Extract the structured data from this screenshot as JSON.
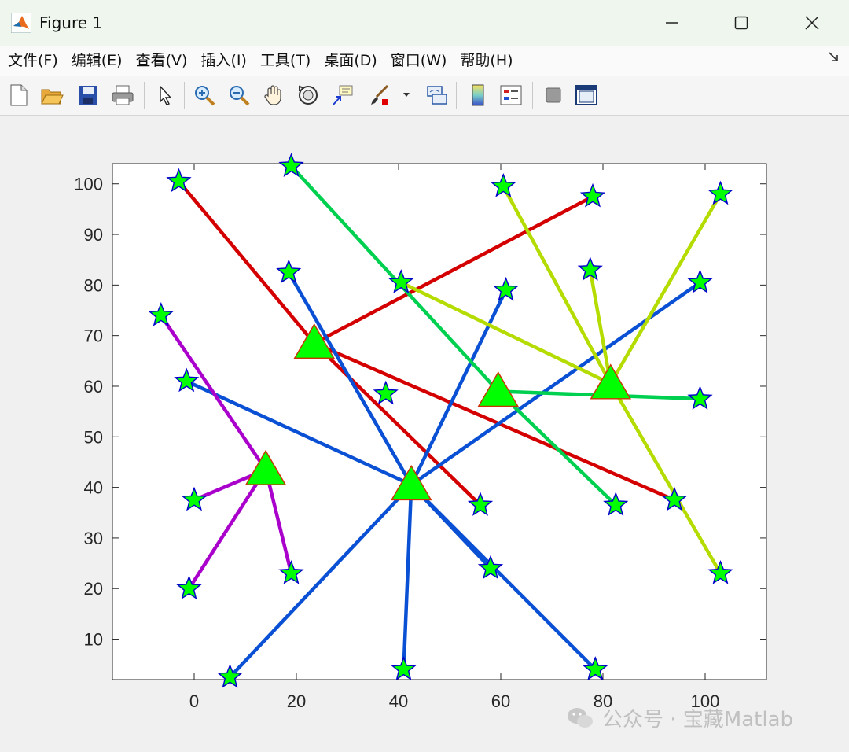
{
  "window": {
    "title": "Figure 1",
    "minimize": "—",
    "maximize": "☐",
    "close": "✕"
  },
  "menu": [
    "文件(F)",
    "编辑(E)",
    "查看(V)",
    "插入(I)",
    "工具(T)",
    "桌面(D)",
    "窗口(W)",
    "帮助(H)"
  ],
  "toolbar": {
    "icons": [
      "new-file-icon",
      "open-folder-icon",
      "save-icon",
      "print-icon",
      "pointer-icon",
      "zoom-in-icon",
      "zoom-out-icon",
      "pan-hand-icon",
      "rotate-3d-icon",
      "data-cursor-icon",
      "brush-icon",
      "link-plot-icon",
      "colorbar-icon",
      "legend-icon",
      "hide-plot-tools-icon",
      "show-plot-tools-icon"
    ]
  },
  "watermark": "公众号 · 宝藏Matlab",
  "colors": {
    "red": "#d40000",
    "blue": "#0a50d4",
    "purple": "#aa00cc",
    "green": "#00d050",
    "yellowgreen": "#b4dc00",
    "marker_fill": "#00ff00",
    "star_edge": "#0000cc",
    "triangle_edge": "#cc3300"
  },
  "chart_data": {
    "type": "scatter",
    "title": "",
    "xlabel": "",
    "ylabel": "",
    "xlim": [
      -16,
      112
    ],
    "ylim": [
      2,
      104
    ],
    "xticks": [
      0,
      20,
      40,
      60,
      80,
      100
    ],
    "yticks": [
      10,
      20,
      30,
      40,
      50,
      60,
      70,
      80,
      90,
      100
    ],
    "grid": false,
    "centers": [
      {
        "color": "red",
        "x": 23.5,
        "y": 68.5
      },
      {
        "color": "blue",
        "x": 42.5,
        "y": 40.5
      },
      {
        "color": "purple",
        "x": 14,
        "y": 43.5
      },
      {
        "color": "green",
        "x": 59.5,
        "y": 59
      },
      {
        "color": "yellowgreen",
        "x": 81.5,
        "y": 60.5
      }
    ],
    "clusters": [
      {
        "center": 0,
        "points": [
          [
            -3,
            100.5
          ],
          [
            78,
            97.5
          ],
          [
            56,
            36.5
          ],
          [
            94,
            37.5
          ]
        ]
      },
      {
        "center": 1,
        "points": [
          [
            18.5,
            82.5
          ],
          [
            61,
            79
          ],
          [
            -1.5,
            61
          ],
          [
            99,
            80.5
          ],
          [
            58,
            24
          ],
          [
            78.5,
            4
          ],
          [
            41,
            4
          ],
          [
            7,
            2.5
          ]
        ]
      },
      {
        "center": 2,
        "points": [
          [
            -6.5,
            74
          ],
          [
            0,
            37.5
          ],
          [
            -1,
            20
          ],
          [
            19,
            23
          ]
        ]
      },
      {
        "center": 3,
        "points": [
          [
            19,
            103.5
          ],
          [
            82.5,
            36.5
          ],
          [
            99,
            57.5
          ]
        ]
      },
      {
        "center": 4,
        "points": [
          [
            60.5,
            99.5
          ],
          [
            103,
            98
          ],
          [
            77.5,
            83
          ],
          [
            40.5,
            80.5
          ],
          [
            103,
            23
          ]
        ]
      }
    ],
    "extra_points": [
      [
        37.5,
        58.5
      ]
    ]
  }
}
